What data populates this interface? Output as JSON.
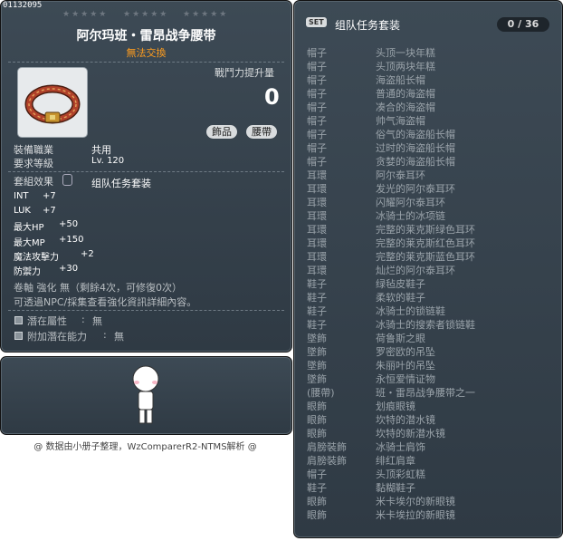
{
  "item": {
    "id": "01132095",
    "stars": [
      "★★★★★",
      "★★★★★",
      "★★★★★"
    ],
    "name": "阿尔玛班・雷昂战争腰带",
    "trade": "無法交換",
    "power_label": "戰鬥力提升量",
    "power_value": "0",
    "tags": [
      "飾品",
      "腰帶"
    ],
    "job_label": "裝備職業",
    "job_value": "共用",
    "level_label": "要求等級",
    "level_value": "Lv. 120",
    "set_effect_label": "套組效果",
    "set_effect_value": "组队任务套装",
    "stats": [
      {
        "name": "INT",
        "value": "+7"
      },
      {
        "name": "LUK",
        "value": "+7"
      },
      {
        "name": "最大HP",
        "value": "+50"
      },
      {
        "name": "最大MP",
        "value": "+150"
      },
      {
        "name": "魔法攻擊力",
        "value": "+2"
      },
      {
        "name": "防禦力",
        "value": "+30"
      }
    ],
    "scroll_info": "卷軸 強化 無（剩餘4次，可修復0次）",
    "hint": "可透過NPC/採集查看強化資訊詳細內容。",
    "potential_label": "潛在屬性",
    "potential_value": "無",
    "additional_label": "附加潛在能力",
    "additional_value": "無",
    "colon": ":"
  },
  "footer": "@ 数据由小册子整理，WzComparerR2-NTMS解析 @",
  "set": {
    "badge": "SET",
    "title": "组队任务套装",
    "count": "0 / 36",
    "items": [
      {
        "type": "帽子",
        "name": "头顶一块年糕"
      },
      {
        "type": "帽子",
        "name": "头顶两块年糕"
      },
      {
        "type": "帽子",
        "name": "海盗船长帽"
      },
      {
        "type": "帽子",
        "name": "普通的海盗帽"
      },
      {
        "type": "帽子",
        "name": "凑合的海盗帽"
      },
      {
        "type": "帽子",
        "name": "帅气海盗帽"
      },
      {
        "type": "帽子",
        "name": "俗气的海盗船长帽"
      },
      {
        "type": "帽子",
        "name": "过时的海盗船长帽"
      },
      {
        "type": "帽子",
        "name": "贪婪的海盗船长帽"
      },
      {
        "type": "耳環",
        "name": "阿尔泰耳环"
      },
      {
        "type": "耳環",
        "name": "发光的阿尔泰耳环"
      },
      {
        "type": "耳環",
        "name": "闪耀阿尔泰耳环"
      },
      {
        "type": "耳環",
        "name": "冰骑士的冰项链"
      },
      {
        "type": "耳環",
        "name": "完整的莱克斯绿色耳环"
      },
      {
        "type": "耳環",
        "name": "完整的莱克斯红色耳环"
      },
      {
        "type": "耳環",
        "name": "完整的莱克斯蓝色耳环"
      },
      {
        "type": "耳環",
        "name": "灿烂的阿尔泰耳环"
      },
      {
        "type": "鞋子",
        "name": "绿毡皮鞋子"
      },
      {
        "type": "鞋子",
        "name": "柔软的鞋子"
      },
      {
        "type": "鞋子",
        "name": "冰骑士的锁链鞋"
      },
      {
        "type": "鞋子",
        "name": "冰骑士的搜索者锁链鞋"
      },
      {
        "type": "墜飾",
        "name": "荷鲁斯之眼"
      },
      {
        "type": "墜飾",
        "name": "罗密欧的吊坠"
      },
      {
        "type": "墜飾",
        "name": "朱丽叶的吊坠"
      },
      {
        "type": "墜飾",
        "name": "永恒爱情证物"
      },
      {
        "type": "(腰帶)",
        "name": "班・雷昂战争腰带之一"
      },
      {
        "type": "眼飾",
        "name": "划痕眼镜"
      },
      {
        "type": "眼飾",
        "name": "坎特的潜水镜"
      },
      {
        "type": "眼飾",
        "name": "坎特的新潜水镜"
      },
      {
        "type": "肩膀裝飾",
        "name": "冰骑士肩饰"
      },
      {
        "type": "肩膀裝飾",
        "name": "绯红肩章"
      },
      {
        "type": "帽子",
        "name": "头顶彩虹糕"
      },
      {
        "type": "鞋子",
        "name": "黏糊鞋子"
      },
      {
        "type": "眼飾",
        "name": "米卡埃尔的新眼镜"
      },
      {
        "type": "眼飾",
        "name": "米卡埃拉的新眼镜"
      }
    ]
  }
}
